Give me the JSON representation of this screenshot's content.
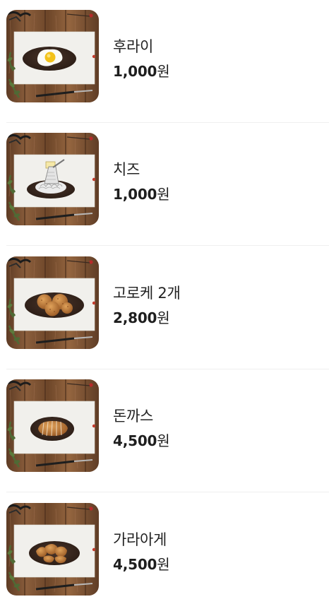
{
  "currency_unit": "원",
  "colors": {
    "text": "#222222",
    "divider": "#efefef",
    "wood": "#7a5234",
    "paper": "#f1f0ec",
    "plate": "#3b2a22"
  },
  "items": [
    {
      "name": "후라이",
      "price": "1,000",
      "image_icon": "fried-egg-icon"
    },
    {
      "name": "치즈",
      "price": "1,000",
      "image_icon": "grated-cheese-icon"
    },
    {
      "name": "고로케 2개",
      "price": "2,800",
      "image_icon": "croquette-icon"
    },
    {
      "name": "돈까스",
      "price": "4,500",
      "image_icon": "pork-cutlet-icon"
    },
    {
      "name": "가라아게",
      "price": "4,500",
      "image_icon": "karaage-icon"
    }
  ]
}
